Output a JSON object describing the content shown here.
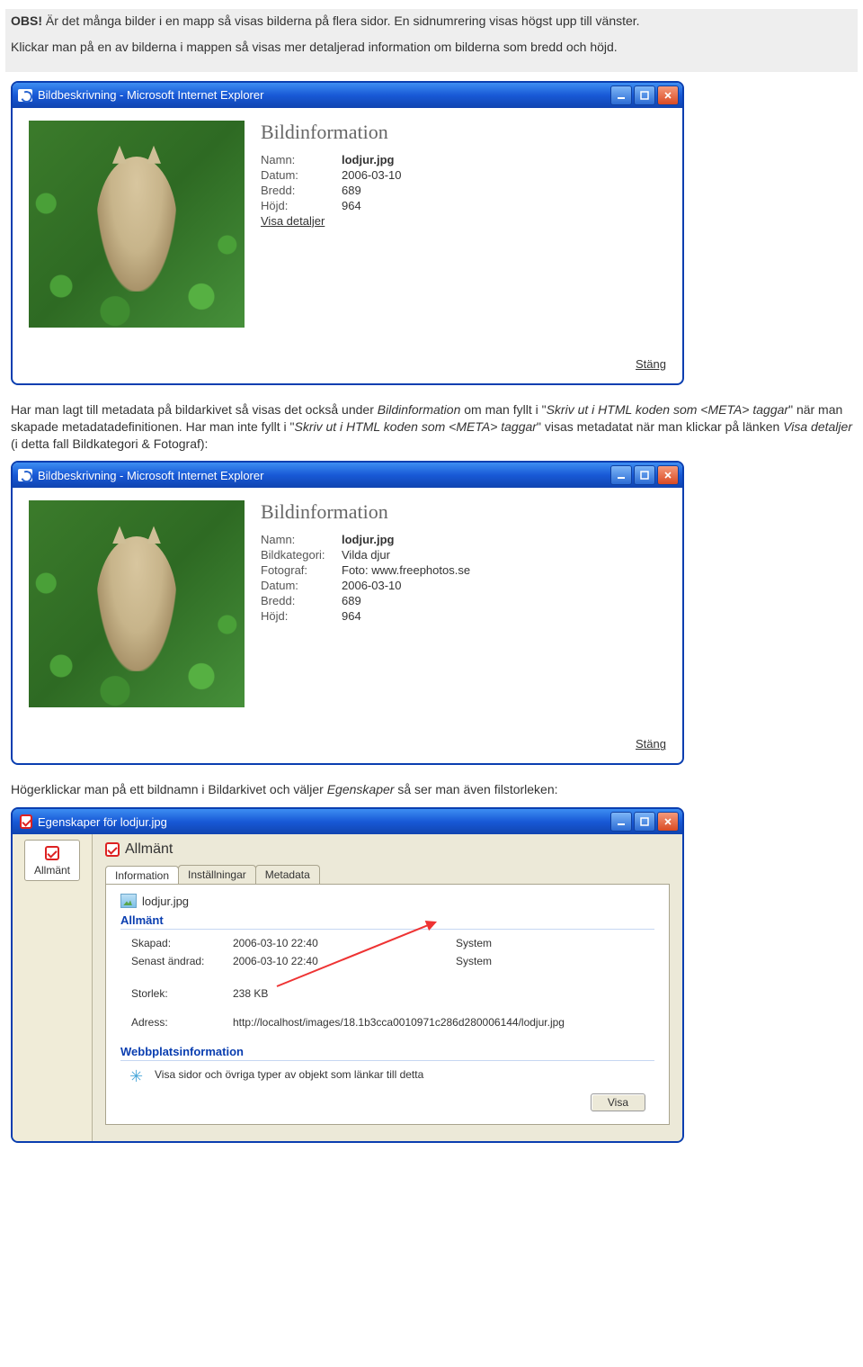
{
  "doc": {
    "p1a": "OBS!",
    "p1b": " Är det många bilder i en mapp så visas bilderna på flera sidor. En sidnumrering visas högst upp till vänster.",
    "p2": "Klickar man på en av bilderna i mappen så visas mer detaljerad information om bilderna som bredd och höjd.",
    "p3a": "Har man lagt till metadata på bildarkivet så visas det också under ",
    "p3b": "Bildinformation",
    "p3c": " om man fyllt i \"",
    "p3d": "Skriv ut i HTML koden som <META> taggar",
    "p3e": "\" när man skapade metadatadefinitionen. Har man inte fyllt i \"",
    "p3f": "Skriv ut i HTML koden som <META> taggar",
    "p3g": "\" visas metadatat när man klickar på länken ",
    "p3h": "Visa detaljer",
    "p3i": " (i detta fall Bildkategori & Fotograf):",
    "p4a": "Högerklickar man på ett bildnamn i Bildarkivet och väljer ",
    "p4b": "Egenskaper",
    "p4c": " så ser man även filstorleken:"
  },
  "ie_title": "Bildbeskrivning - Microsoft Internet Explorer",
  "info_title": "Bildinformation",
  "info1": {
    "namn_l": "Namn:",
    "namn_v": "lodjur.jpg",
    "datum_l": "Datum:",
    "datum_v": "2006-03-10",
    "bredd_l": "Bredd:",
    "bredd_v": "689",
    "hojd_l": "Höjd:",
    "hojd_v": "964",
    "detaljer": "Visa detaljer"
  },
  "info2": {
    "namn_l": "Namn:",
    "namn_v": "lodjur.jpg",
    "kat_l": "Bildkategori:",
    "kat_v": "Vilda djur",
    "foto_l": "Fotograf:",
    "foto_v": "Foto: www.freephotos.se",
    "datum_l": "Datum:",
    "datum_v": "2006-03-10",
    "bredd_l": "Bredd:",
    "bredd_v": "689",
    "hojd_l": "Höjd:",
    "hojd_v": "964"
  },
  "stang": "Stäng",
  "props": {
    "title": "Egenskaper för lodjur.jpg",
    "side_tab": "Allmänt",
    "section": "Allmänt",
    "tabs": [
      "Information",
      "Inställningar",
      "Metadata"
    ],
    "filename": "lodjur.jpg",
    "group1": "Allmänt",
    "skapad_l": "Skapad:",
    "skapad_v": "2006-03-10 22:40",
    "skapad_by": "System",
    "andrad_l": "Senast ändrad:",
    "andrad_v": "2006-03-10 22:40",
    "andrad_by": "System",
    "storlek_l": "Storlek:",
    "storlek_v": "238 KB",
    "adress_l": "Adress:",
    "adress_v": "http://localhost/images/18.1b3cca0010971c286d280006144/lodjur.jpg",
    "group2": "Webbplatsinformation",
    "webline": "Visa sidor och övriga typer av objekt som länkar till detta",
    "visa_btn": "Visa"
  }
}
